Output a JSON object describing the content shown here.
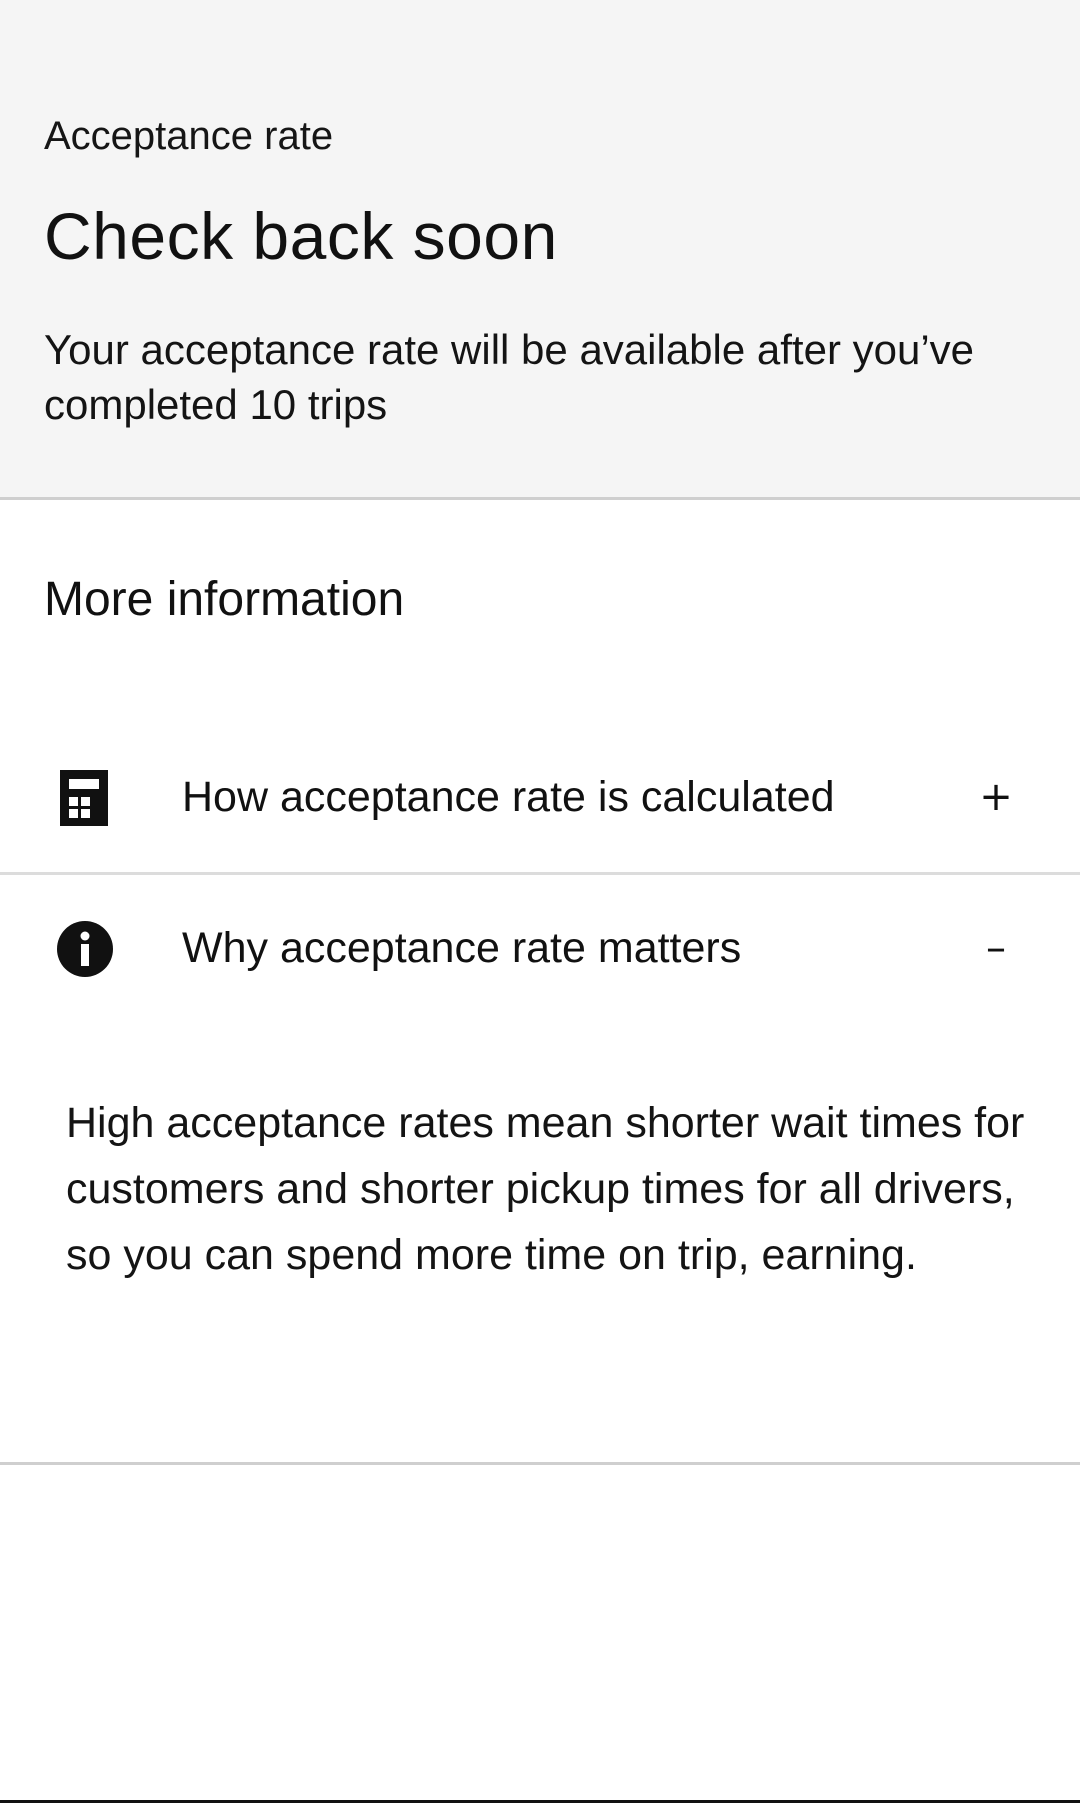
{
  "header": {
    "label": "Acceptance rate",
    "title": "Check back soon",
    "description": "Your acceptance rate will be available after you’ve completed 10 trips"
  },
  "section": {
    "title": "More information"
  },
  "accordion": {
    "items": [
      {
        "icon": "calculator-icon",
        "title": "How acceptance rate is calculated",
        "toggle": "+",
        "expanded": false
      },
      {
        "icon": "info-icon",
        "title": "Why acceptance rate matters",
        "toggle": "–",
        "expanded": true,
        "body": "High acceptance rates mean shorter wait times for customers and shorter pickup times for all drivers, so you can spend more time on trip, earning."
      }
    ]
  }
}
